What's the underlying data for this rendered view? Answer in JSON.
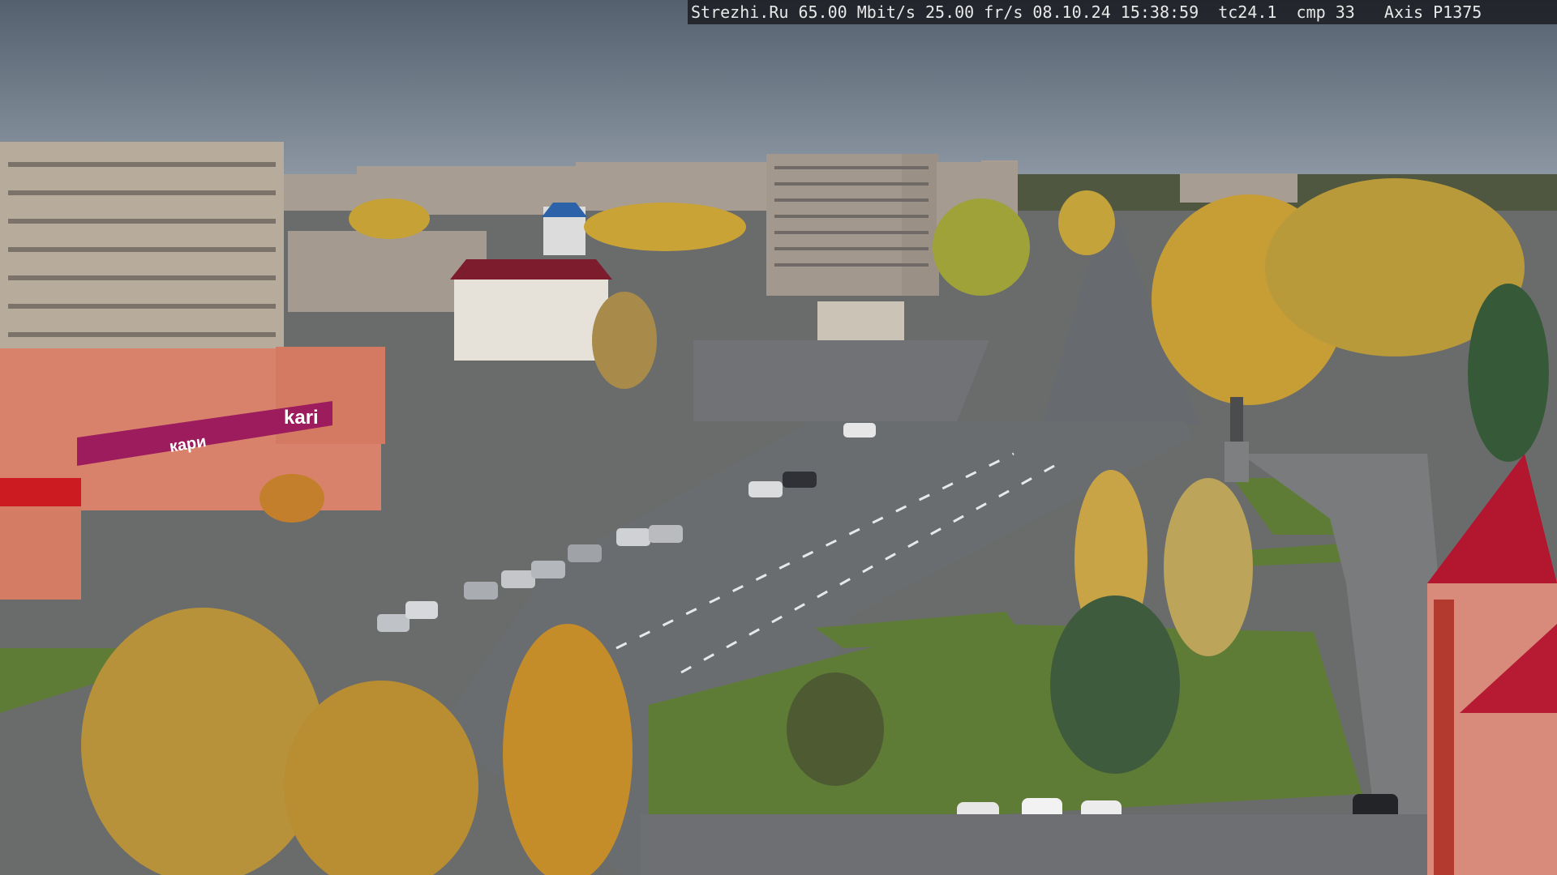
{
  "osd": {
    "text": "Strezhi.Ru 65.00 Mbit/s 25.00 fr/s 08.10.24 15:38:59  tc24.1  cmp 33   Axis P1375"
  },
  "signs": {
    "store_kari": "kari",
    "store_banner": "кари"
  },
  "colors": {
    "sky": "#5e6b7b",
    "asphalt": "#6d7073",
    "grass": "#5b7a35",
    "foliage": "#c9a23a",
    "brand_kari": "#a0185f"
  }
}
